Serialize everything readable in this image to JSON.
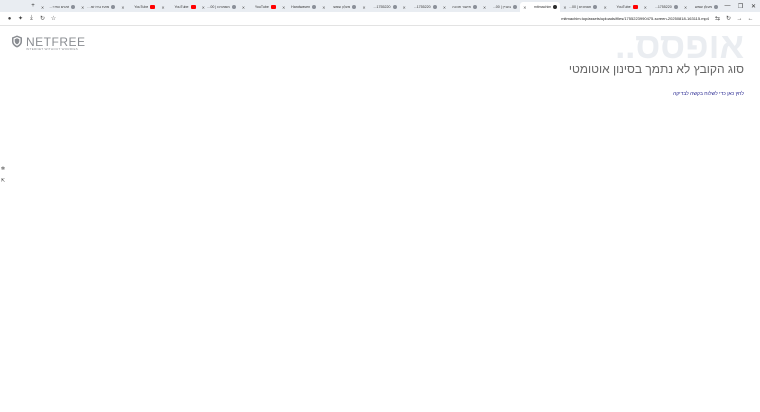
{
  "tabs": [
    {
      "title": "מעלון שמש"
    },
    {
      "title": "1755220..."
    },
    {
      "title": "YouTube"
    },
    {
      "title": "מסמכים | 00..."
    },
    {
      "title": "mitmachim",
      "active": true
    },
    {
      "title": "בעניין | 00..."
    },
    {
      "title": "אישור תוכנה"
    },
    {
      "title": "1755220..."
    },
    {
      "title": "1755220..."
    },
    {
      "title": "מעלון שמש"
    },
    {
      "title": "Handwaven"
    },
    {
      "title": "YouTube"
    },
    {
      "title": "מסמכים | 00..."
    },
    {
      "title": "YouTube"
    },
    {
      "title": "YouTube"
    },
    {
      "title": "מאת גרוז זמנים"
    },
    {
      "title": "זמנים וסדר..."
    }
  ],
  "address_bar": {
    "url": "mitmachim.top/assets/uploads/files/1755223990475-screen-20250818-163115.mp4"
  },
  "page": {
    "big_title": "אופסס..",
    "subtitle": "סוג הקובץ לא נתמך בסינון אוטומטי",
    "link_text": "לחץ כאן כדי לשלוח בקשה לבדיקה",
    "logo_text": "NETFREE",
    "logo_tagline": "INTERNET WITHOUT WORRIES"
  },
  "colors": {
    "tabbar_bg": "#e9edf2",
    "youtube_red": "#ff0000",
    "big_title": "#eaedf1",
    "subtitle": "#666666",
    "link": "#1a1a8a"
  }
}
